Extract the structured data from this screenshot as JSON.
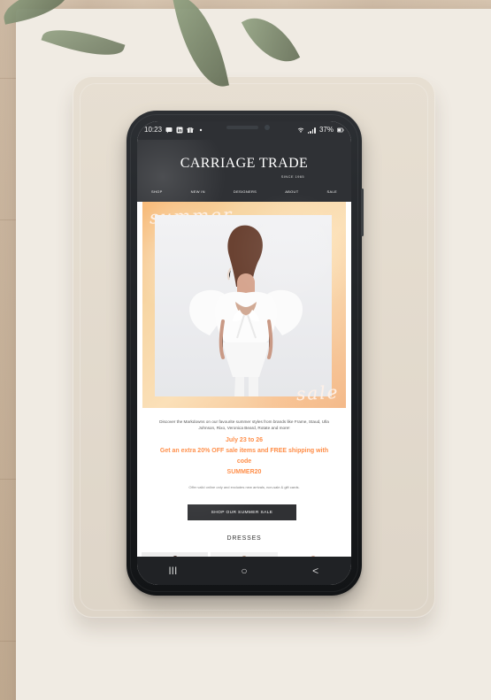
{
  "status_bar": {
    "time": "10:23",
    "right_text": "37%",
    "icons": [
      "message-icon",
      "linkedin-icon",
      "gift-icon",
      "dot-icon",
      "wifi-icon",
      "signal-icon",
      "battery-icon"
    ]
  },
  "header": {
    "brand": "CARRIAGE TRADE",
    "since": "SINCE 1965",
    "nav": [
      "SHOP",
      "NEW IN",
      "DESIGNERS",
      "ABOUT",
      "SALE"
    ]
  },
  "hero": {
    "script_top": "summer",
    "script_bottom": "sale"
  },
  "copy": {
    "intro": "Discover the Markdowns on our favourite summer styles from brands like Frame, Staud, Ulla Johnson, Rixo, Veronica Beard, Rotate and more!",
    "date": "July 23 to 26",
    "offer": "Get an extra 20% OFF sale items and FREE shipping with code",
    "code": "SUMMER20",
    "note": "Offer valid online only and excludes new arrivals, non-sale & gift cards."
  },
  "cta": {
    "label": "SHOP OUR SUMMER SALE"
  },
  "section": {
    "title": "DRESSES"
  },
  "bottom_nav": {
    "recent": "III",
    "home": "○",
    "back": "<"
  },
  "colors": {
    "accent_orange": "#ff8d47",
    "phone_dark": "#2f3135"
  }
}
